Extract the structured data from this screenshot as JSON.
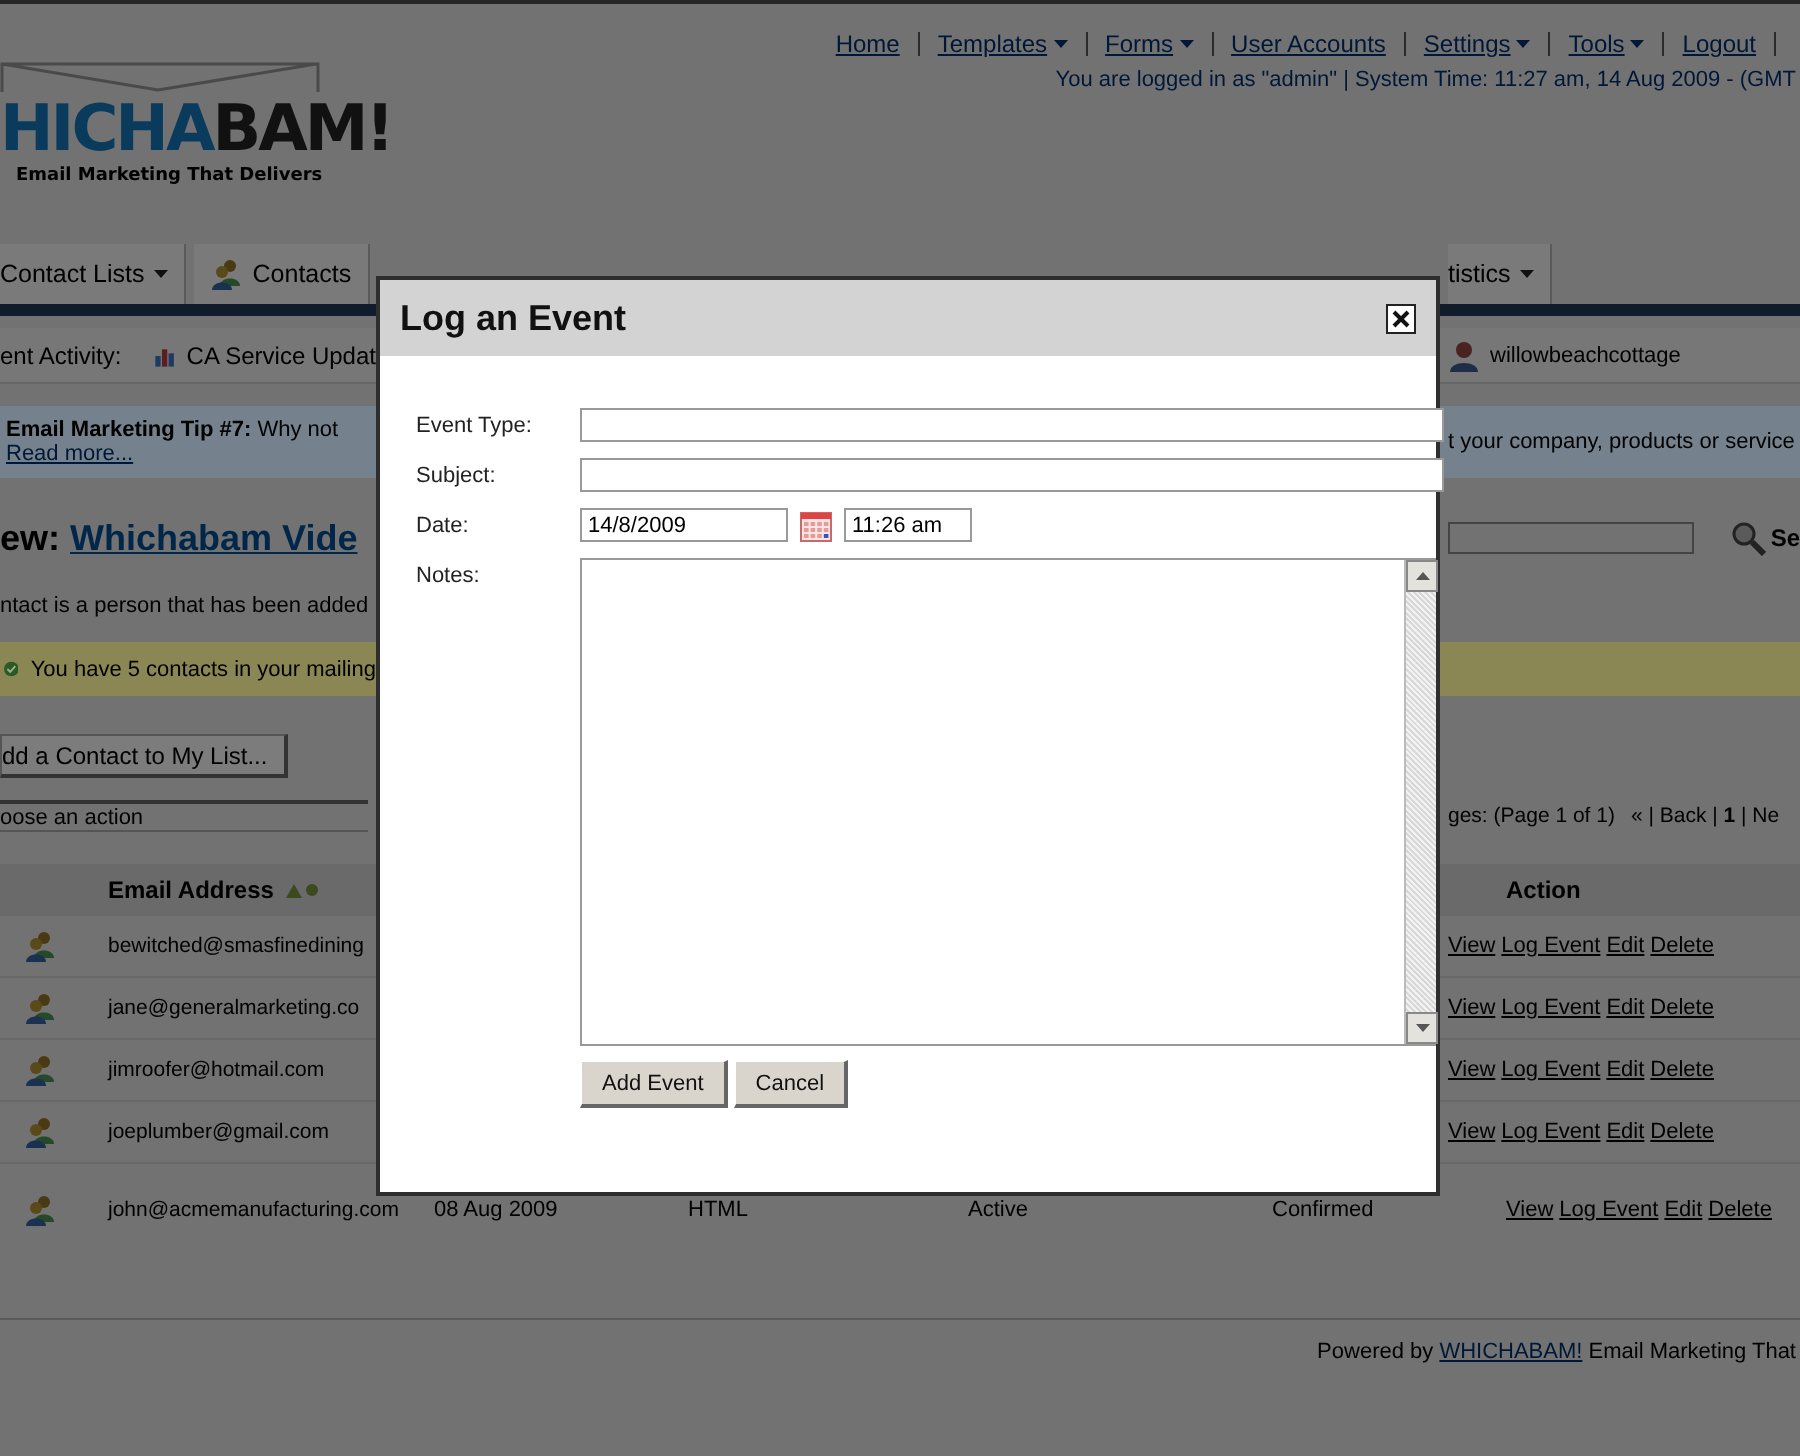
{
  "top_nav": {
    "links": [
      {
        "label": "Home",
        "dropdown": false
      },
      {
        "label": "Templates",
        "dropdown": true
      },
      {
        "label": "Forms",
        "dropdown": true
      },
      {
        "label": "User Accounts",
        "dropdown": false
      },
      {
        "label": "Settings",
        "dropdown": true
      },
      {
        "label": "Tools",
        "dropdown": true
      },
      {
        "label": "Logout",
        "dropdown": false
      }
    ],
    "status": "You are logged in as \"admin\" | System Time: 11:27 am, 14 Aug 2009 - (GMT"
  },
  "logo": {
    "wordmark": [
      {
        "text": "HICHA",
        "color": "#0a3a5c"
      },
      {
        "text": "BAM!",
        "color": "#111111"
      }
    ],
    "tagline": "Email Marketing That Delivers"
  },
  "main_tabs_left": [
    {
      "label": "Contact Lists",
      "dropdown": true
    },
    {
      "label": "Contacts",
      "dropdown": false
    }
  ],
  "main_tabs_right": [
    {
      "label": "tistics",
      "dropdown": true
    }
  ],
  "activity": {
    "label": "ent Activity:",
    "left_item": "CA Service Updat",
    "right_item": "willowbeachcottage"
  },
  "tip": {
    "title": "Email Marketing Tip #7:",
    "text_left": "Why not",
    "text_right": "t your company, products or service",
    "link": "Read more..."
  },
  "list_heading": {
    "prefix": "ew:",
    "link": "Whichabam Vide"
  },
  "description": "ntact is a person that has been added",
  "notice": "You have 5 contacts in your mailing",
  "add_button": "dd a Contact to My List...",
  "action_select": "oose an action",
  "search_button": "Se",
  "pagination": {
    "summary": "ges: (Page 1 of 1)",
    "links": "« | Back | **1** | Ne"
  },
  "table": {
    "columns": {
      "email": "Email Address",
      "action": "Action"
    },
    "rows": [
      {
        "email": "bewitched@smasfinedining",
        "cells": [],
        "actions": [
          "View",
          "Log Event",
          "Edit",
          "Delete"
        ]
      },
      {
        "email": "jane@generalmarketing.co",
        "cells": [],
        "actions": [
          "View",
          "Log Event",
          "Edit",
          "Delete"
        ]
      },
      {
        "email": "jimroofer@hotmail.com",
        "cells": [],
        "actions": [
          "View",
          "Log Event",
          "Edit",
          "Delete"
        ]
      },
      {
        "email": "joeplumber@gmail.com",
        "cells": [],
        "actions": [
          "View",
          "Log Event",
          "Edit",
          "Delete"
        ]
      },
      {
        "email": "john@acmemanufacturing.com",
        "cells": [
          "08 Aug 2009",
          "HTML",
          "Active",
          "Confirmed"
        ],
        "actions": [
          "View",
          "Log Event",
          "Edit",
          "Delete"
        ]
      }
    ]
  },
  "footer": {
    "before": "Powered by",
    "link": "WHICHABAM!",
    "after": "Email Marketing That"
  },
  "dialog": {
    "title": "Log an Event",
    "fields": [
      {
        "label": "Event Type:",
        "kind": "text"
      },
      {
        "label": "Subject:",
        "kind": "text"
      },
      {
        "label": "Date:",
        "kind": "date",
        "value": "14/8/2009",
        "time": "11:26 am"
      },
      {
        "label": "Notes:",
        "kind": "textarea"
      }
    ],
    "buttons": [
      "Add Event",
      "Cancel"
    ]
  }
}
